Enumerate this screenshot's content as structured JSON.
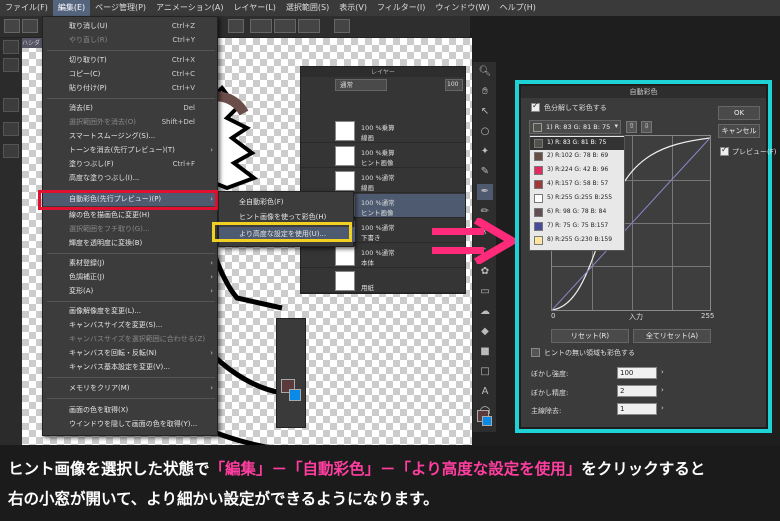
{
  "menubar": [
    {
      "label": "ファイル(F)"
    },
    {
      "label": "編集(E)"
    },
    {
      "label": "ページ管理(P)"
    },
    {
      "label": "アニメーション(A)"
    },
    {
      "label": "レイヤー(L)"
    },
    {
      "label": "選択範囲(S)"
    },
    {
      "label": "表示(V)"
    },
    {
      "label": "フィルター(I)"
    },
    {
      "label": "ウィンドウ(W)"
    },
    {
      "label": "ヘルプ(H)"
    }
  ],
  "doc_tab": "ハシダ",
  "edit_menu": {
    "items": [
      {
        "label": "取り消し(U)",
        "shortcut": "Ctrl+Z"
      },
      {
        "label": "やり直し(R)",
        "shortcut": "Ctrl+Y"
      },
      {
        "label": "切り取り(T)",
        "shortcut": "Ctrl+X"
      },
      {
        "label": "コピー(C)",
        "shortcut": "Ctrl+C"
      },
      {
        "label": "貼り付け(P)",
        "shortcut": "Ctrl+V"
      },
      {
        "label": "消去(E)",
        "shortcut": "Del"
      },
      {
        "label": "選択範囲外を消去(O)",
        "shortcut": "Shift+Del"
      },
      {
        "label": "スマートスムージング(S)..."
      },
      {
        "label": "トーンを消去(先行プレビュー)(T)"
      },
      {
        "label": "塗りつぶし(F)",
        "shortcut": "Ctrl+F"
      },
      {
        "label": "高度な塗りつぶし(I)..."
      },
      {
        "label": "自動彩色(先行プレビュー)(P)"
      },
      {
        "label": "線の色を描画色に変更(H)"
      },
      {
        "label": "選択範囲をフチ取り(G)..."
      },
      {
        "label": "輝度を透明度に変換(B)"
      },
      {
        "label": "素材登録(J)"
      },
      {
        "label": "色調補正(J)"
      },
      {
        "label": "変形(A)"
      },
      {
        "label": "画像解像度を変更(L)..."
      },
      {
        "label": "キャンバスサイズを変更(S)..."
      },
      {
        "label": "キャンバスサイズを選択範囲に合わせる(Z)"
      },
      {
        "label": "キャンバスを回転・反転(N)"
      },
      {
        "label": "キャンバス基本設定を変更(V)..."
      },
      {
        "label": "メモリをクリア(M)"
      },
      {
        "label": "画面の色を取得(X)"
      },
      {
        "label": "ウインドウを隠して画面の色を取得(Y)..."
      }
    ]
  },
  "submenu": {
    "items": [
      {
        "label": "全自動彩色(F)"
      },
      {
        "label": "ヒント画像を使って彩色(H)"
      },
      {
        "label": "より高度な設定を使用(U)..."
      }
    ]
  },
  "layer_panel": {
    "title": "レイヤー",
    "blend_mode": "通常",
    "opacity": "100",
    "layers": [
      {
        "line1": "100 %乗算",
        "line2": "線画"
      },
      {
        "line1": "100 %乗算",
        "line2": "ヒント画像"
      },
      {
        "line1": "100 %通常",
        "line2": "線画"
      },
      {
        "line1": "100 %通常",
        "line2": "ヒント画像"
      },
      {
        "line1": "100 %通常",
        "line2": "下書き"
      },
      {
        "line1": "100 %通常",
        "line2": "本体"
      },
      {
        "line1": "",
        "line2": "用紙"
      }
    ]
  },
  "dialog": {
    "title": "自動彩色",
    "separate_checkbox": "色分解して彩色する",
    "selected_color": "1) R: 83 G: 81 B: 75",
    "ok": "OK",
    "cancel": "キャンセル",
    "preview": "プレビュー(F)",
    "colors": [
      {
        "label": "1) R: 83 G: 81 B: 75",
        "hex": "#53514b"
      },
      {
        "label": "2) R:102 G: 78 B: 69",
        "hex": "#664e45"
      },
      {
        "label": "3) R:224 G: 42 B: 96",
        "hex": "#e02a60"
      },
      {
        "label": "4) R:157 G: 58 B: 57",
        "hex": "#9d3a39"
      },
      {
        "label": "5) R:255 G:255 B:255",
        "hex": "#ffffff"
      },
      {
        "label": "6) R: 98 G: 78 B: 84",
        "hex": "#624e54"
      },
      {
        "label": "7) R: 75 G: 75 B:157",
        "hex": "#4b4b9d"
      },
      {
        "label": "8) R:255 G:230 B:159",
        "hex": "#ffe69f"
      }
    ],
    "curve_output_label": "出力",
    "curve_input_label": "入力",
    "curve_min": "0",
    "curve_max": "255",
    "reset_button": "リセット(R)",
    "reset_all_button": "全てリセット(A)",
    "hint_checkbox": "ヒントの無い領域も彩色する",
    "blur_strength_label": "ぼかし強度:",
    "blur_strength_value": "100",
    "blur_precision_label": "ぼかし精度:",
    "blur_precision_value": "2",
    "main_removal_label": "主線除去:",
    "main_removal_value": "1"
  },
  "caption": {
    "line1_a": "ヒント画像を選択した状態で",
    "line1_b": "「編集」－「自動彩色」－「より高度な設定を使用」",
    "line1_c": "をクリックすると",
    "line2": "右の小窓が開いて、より細かい設定ができるようになります。"
  },
  "colors": {
    "red_box": "#e01030",
    "yellow_box": "#f0d020",
    "cyan_box": "#1ed2d6",
    "arrow": "#ff2a7a",
    "caption_highlight": "#ff3ea0"
  }
}
